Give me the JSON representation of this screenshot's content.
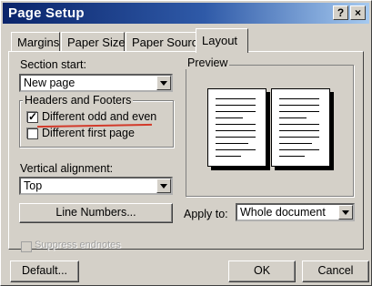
{
  "window": {
    "title": "Page Setup",
    "help_btn": "?",
    "close_btn": "×"
  },
  "tabs": [
    "Margins",
    "Paper Size",
    "Paper Source",
    "Layout"
  ],
  "active_tab": "Layout",
  "section_start": {
    "label": "Section start:",
    "value": "New page"
  },
  "headers_footers": {
    "label": "Headers and Footers",
    "different_odd_even": {
      "label": "Different odd and even",
      "checked": true
    },
    "different_first_page": {
      "label": "Different first page",
      "checked": false
    }
  },
  "vertical_alignment": {
    "label": "Vertical alignment:",
    "value": "Top"
  },
  "line_numbers_button": "Line Numbers...",
  "preview": {
    "label": "Preview"
  },
  "apply_to": {
    "label": "Apply to:",
    "value": "Whole document"
  },
  "suppress_endnotes": {
    "label": "Suppress endnotes",
    "enabled": false
  },
  "buttons": {
    "default": "Default...",
    "ok": "OK",
    "cancel": "Cancel"
  },
  "colors": {
    "title_start": "#0a246a",
    "title_end": "#a6caf0",
    "face": "#d4d0c8",
    "highlight_stroke": "#d23a2a"
  }
}
